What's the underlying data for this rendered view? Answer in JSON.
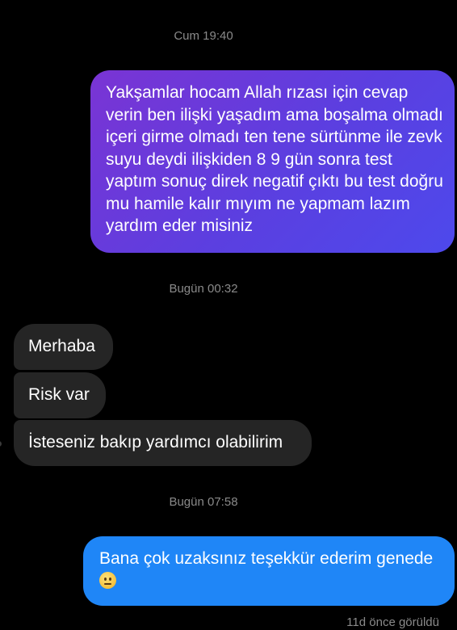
{
  "conversation": {
    "timestamp_1": "Cum 19:40",
    "outgoing_1": "Yakşamlar hocam Allah rızası için cevap verin ben ilişki yaşadım ama boşalma olmadı içeri girme olmadı ten tene sürtünme ile zevk suyu deydi ilişkiden 8 9 gün sonra test yaptım sonuç direk negatif çıktı bu test doğru mu hamile kalır mıyım ne yapmam lazım yardım eder misiniz",
    "timestamp_2": "Bugün 00:32",
    "incoming": [
      "Merhaba",
      "Risk var",
      "İsteseniz bakıp yardımcı olabilirim"
    ],
    "timestamp_3": "Bugün 07:58",
    "outgoing_2": "Bana çok uzaksınız teşekkür ederim genede",
    "outgoing_2_emoji": "confused-face-icon",
    "seen_status": "11d önce görüldü"
  },
  "colors": {
    "background": "#000000",
    "incoming_bubble": "#252525",
    "outgoing_gradient_start": "#7a34d4",
    "outgoing_gradient_end": "#4d49ec",
    "outgoing_blue": "#1f86f7",
    "timestamp_text": "#8a8a8a"
  }
}
